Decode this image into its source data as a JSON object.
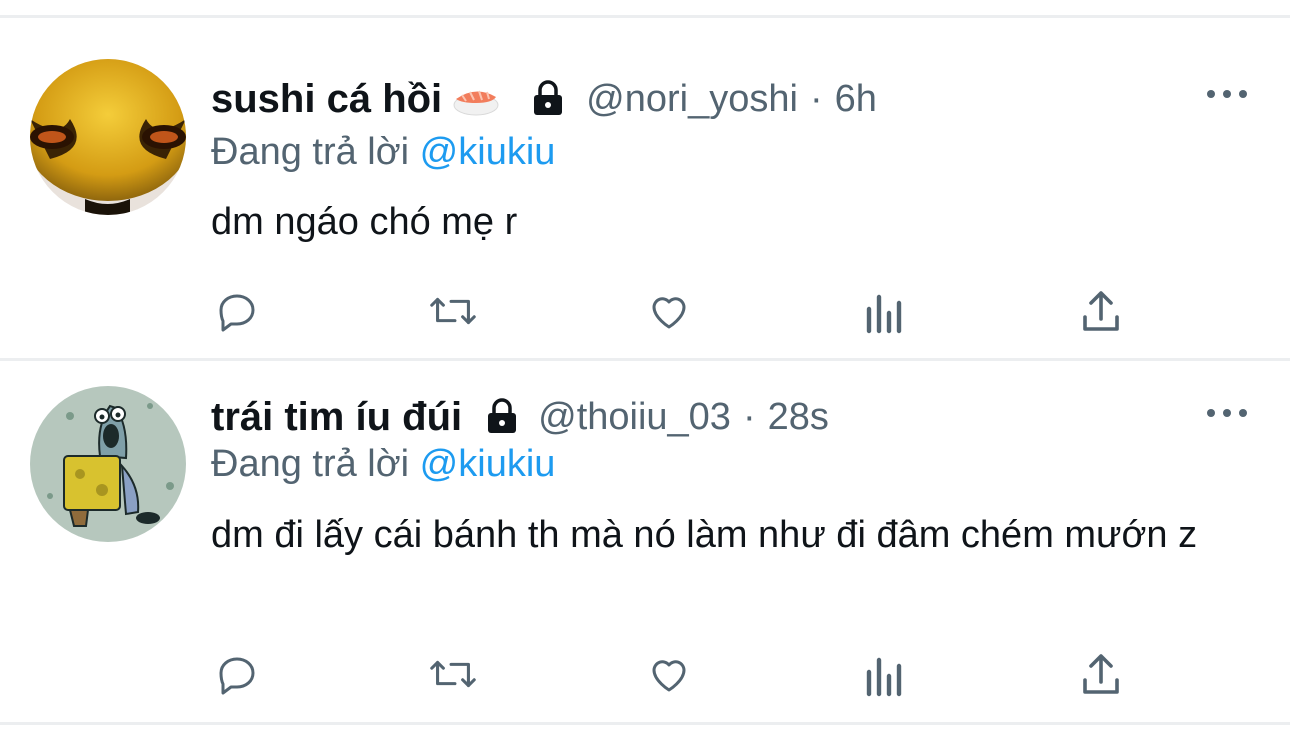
{
  "tweets": [
    {
      "display_name": "sushi cá hồi",
      "name_emoji": "sushi-emoji",
      "protected_icon": "lock-icon",
      "handle": "@nori_yoshi",
      "separator": "·",
      "time": "6h",
      "replying_prefix": "Đang trả lời",
      "replying_to": "@kiukiu",
      "text": "dm ngáo chó mẹ r",
      "avatar": "yellow-alien-face-avatar"
    },
    {
      "display_name": "trái tim íu đúi",
      "protected_icon": "lock-icon",
      "handle": "@thoiiu_03",
      "separator": "·",
      "time": "28s",
      "replying_prefix": "Đang trả lời",
      "replying_to": "@kiukiu",
      "text": "dm đi lấy cái bánh th mà nó làm như đi đâm chém mướn z",
      "avatar": "spongebob-cartoon-avatar"
    }
  ],
  "actions": [
    "reply-icon",
    "retweet-icon",
    "like-icon",
    "analytics-icon",
    "share-icon"
  ],
  "colors": {
    "text_primary": "#0f1419",
    "text_secondary": "#536471",
    "mention": "#1d9bf0",
    "divider": "#eceef0"
  }
}
